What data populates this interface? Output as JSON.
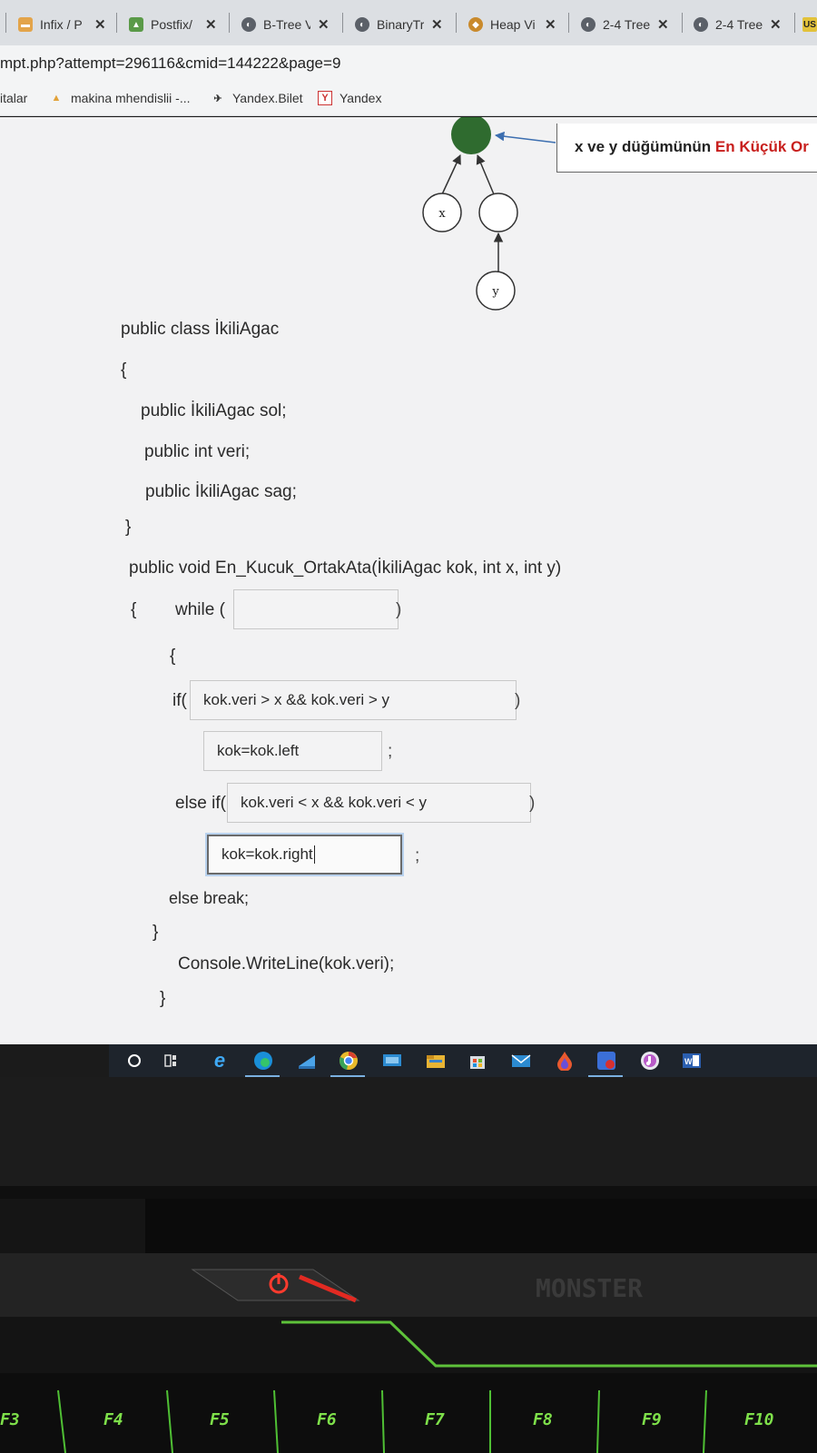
{
  "browser": {
    "tabs": [
      {
        "label": "Infix / P",
        "icon": "tab-favicon-icon"
      },
      {
        "label": "Postfix/",
        "icon": "tab-favicon-icon"
      },
      {
        "label": "B-Tree V",
        "icon": "globe-icon"
      },
      {
        "label": "BinaryTr",
        "icon": "globe-icon"
      },
      {
        "label": "Heap Vi",
        "icon": "tab-favicon-icon"
      },
      {
        "label": "2-4 Tree",
        "icon": "globe-icon"
      },
      {
        "label": "2-4 Tree",
        "icon": "globe-icon"
      },
      {
        "label": "US",
        "icon": "tab-favicon-icon"
      }
    ],
    "close_glyph": "✕",
    "url": "mpt.php?attempt=296116&cmid=144222&page=9",
    "bookmarks": [
      {
        "label": "italar"
      },
      {
        "label": "makina mhendislii -..."
      },
      {
        "label": "Yandex.Bilet"
      },
      {
        "label": "Yandex"
      }
    ]
  },
  "diagram": {
    "callout": {
      "prefix": "x ve y düğümünün",
      "highlight": "En Küçük Or"
    },
    "node_x": "x",
    "node_y": "y",
    "colors": {
      "root": "#2f6b2f",
      "arrow": "#3d6fb0",
      "highlight": "#c8201e"
    }
  },
  "code": {
    "class_decl": "public class İkiliAgac",
    "open_brace_1": "{",
    "field_sol": "public İkiliAgac sol;",
    "field_veri": "public int veri;",
    "field_sag": "public İkiliAgac sag;",
    "close_brace_1": "}",
    "method_sig": "public void En_Kucuk_OrtakAta(İkiliAgac kok, int x, int y)",
    "open_brace_2": "{",
    "while_kw": "while (",
    "while_close": ")",
    "open_brace_3": "{",
    "if_kw": "if(",
    "if_close": ")",
    "semi_1": ";",
    "elseif_kw": "else if(",
    "elseif_close": ")",
    "semi_2": ";",
    "else_break": "else break;",
    "close_brace_3": "}",
    "console": "Console.WriteLine(kok.veri);",
    "close_brace_2": "}"
  },
  "answers": {
    "while_cond": "",
    "if_cond": "kok.veri > x && kok.veri > y",
    "if_body": "kok=kok.left",
    "elseif_cond": "kok.veri < x && kok.veri < y",
    "elseif_body": "kok=kok.right"
  },
  "keyboard": {
    "fkeys": [
      "F3",
      "F4",
      "F5",
      "F6",
      "F7",
      "F8",
      "F9",
      "F10"
    ],
    "brand": "MONSTER"
  }
}
